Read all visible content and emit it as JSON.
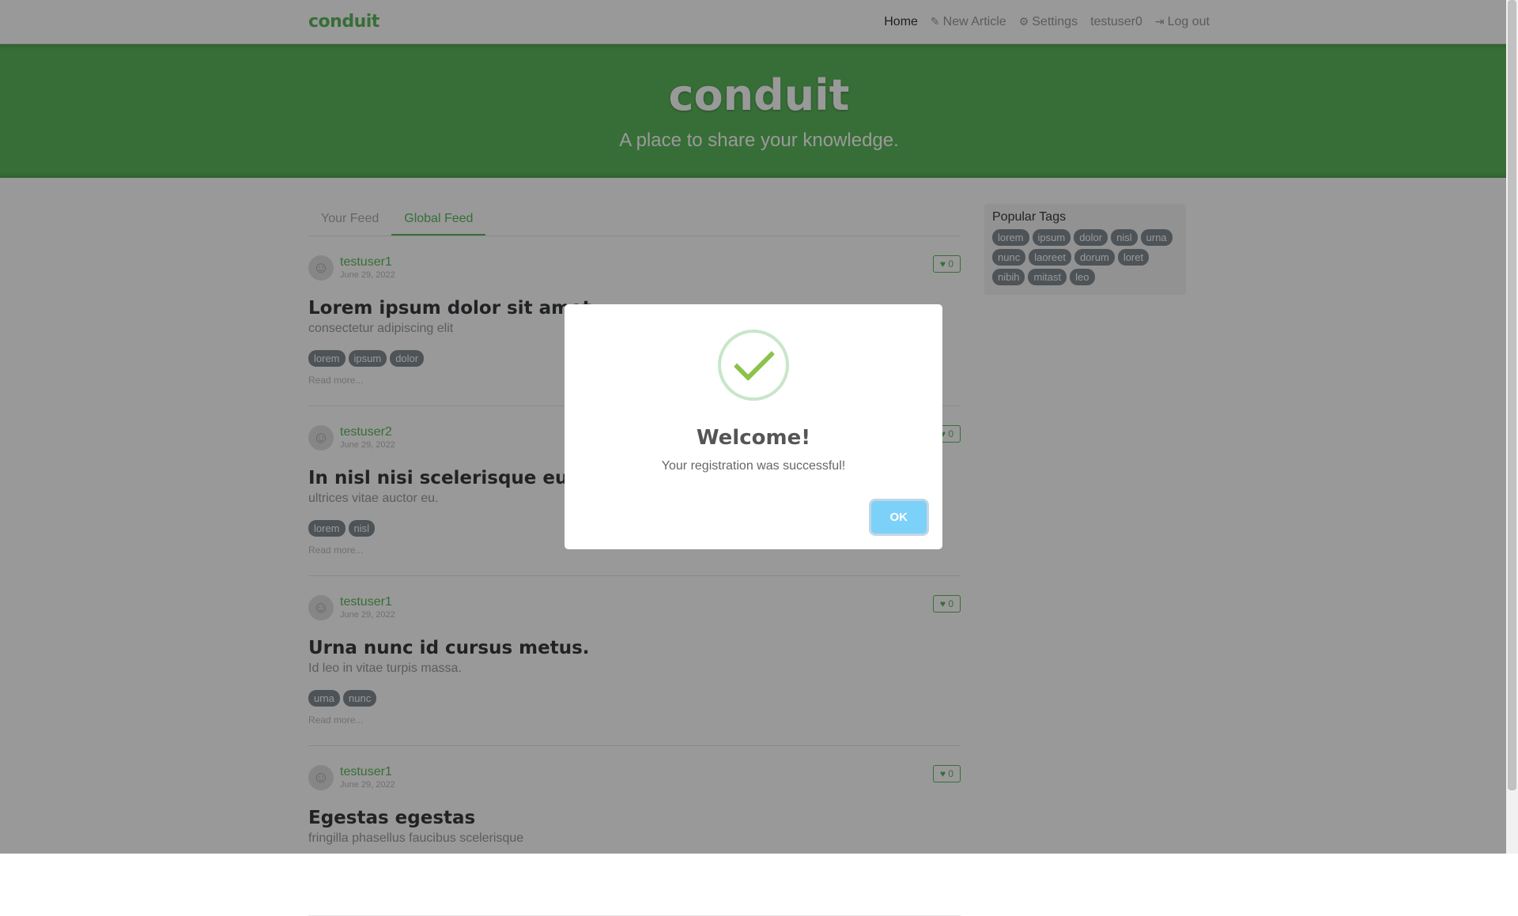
{
  "navbar": {
    "brand": "conduit",
    "links": [
      {
        "label": "Home",
        "icon": ""
      },
      {
        "label": "New Article",
        "icon": "edit-icon"
      },
      {
        "label": "Settings",
        "icon": "gear-icon"
      },
      {
        "label": "testuser0",
        "icon": ""
      },
      {
        "label": "Log out",
        "icon": "logout-icon"
      }
    ]
  },
  "banner": {
    "title": "conduit",
    "subtitle": "A place to share your knowledge."
  },
  "feed": {
    "tabs": [
      "Your Feed",
      "Global Feed"
    ],
    "articles": [
      {
        "author": "testuser1",
        "date": "June 29, 2022",
        "favorites": "0",
        "title": "Lorem ipsum dolor sit amet",
        "description": "consectetur adipiscing elit",
        "tags": [
          "lorem",
          "ipsum",
          "dolor"
        ],
        "read_more": "Read more..."
      },
      {
        "author": "testuser2",
        "date": "June 29, 2022",
        "favorites": "0",
        "title": "In nisl nisi scelerisque eu",
        "description": "ultrices vitae auctor eu.",
        "tags": [
          "lorem",
          "nisl"
        ],
        "read_more": "Read more..."
      },
      {
        "author": "testuser1",
        "date": "June 29, 2022",
        "favorites": "0",
        "title": "Urna nunc id cursus metus.",
        "description": "Id leo in vitae turpis massa.",
        "tags": [
          "urna",
          "nunc"
        ],
        "read_more": "Read more..."
      },
      {
        "author": "testuser1",
        "date": "June 29, 2022",
        "favorites": "0",
        "title": "Egestas egestas",
        "description": "fringilla phasellus faucibus scelerisque",
        "tags": [],
        "read_more": ""
      }
    ]
  },
  "sidebar": {
    "title": "Popular Tags",
    "tags": [
      "lorem",
      "ipsum",
      "dolor",
      "nisl",
      "urna",
      "nunc",
      "laoreet",
      "dorum",
      "loret",
      "nibih",
      "mitast",
      "leo"
    ]
  },
  "modal": {
    "title": "Welcome!",
    "text": "Your registration was successful!",
    "ok_label": "OK"
  },
  "colors": {
    "accent": "#5cb85c",
    "ok_button": "#7cd1f9",
    "tag": "#818a91"
  }
}
